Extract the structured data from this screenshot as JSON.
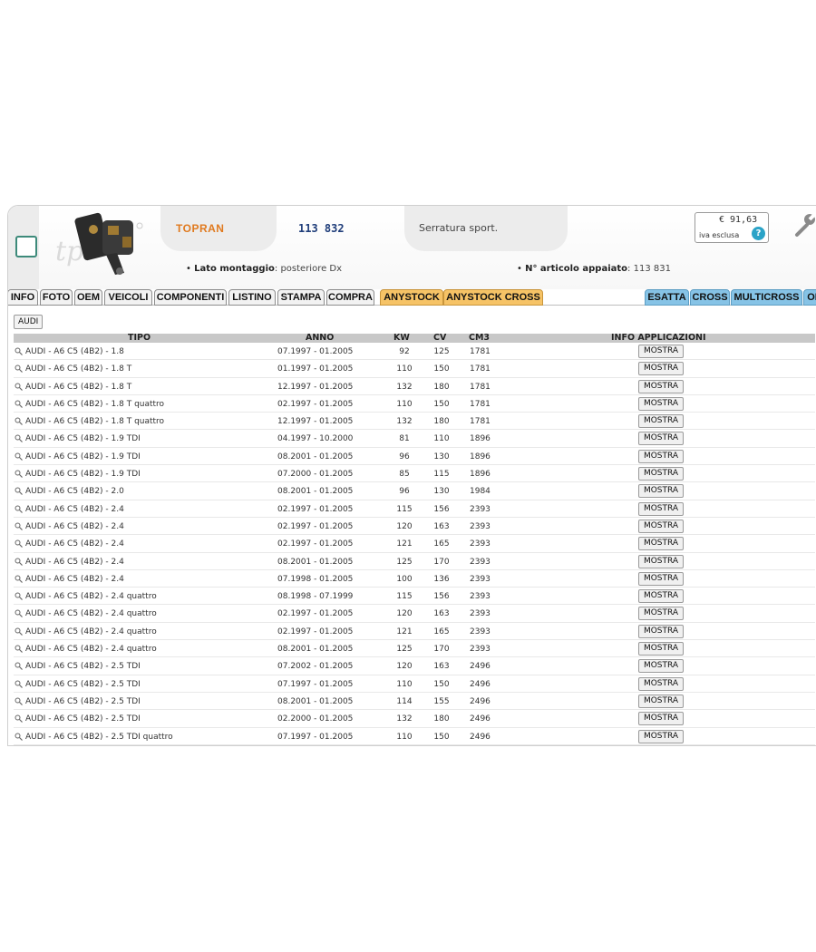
{
  "header": {
    "brand": "TOPRAN",
    "article_number": "113 832",
    "description": "Serratura sport.",
    "price": "€ 91,63",
    "price_note": "iva esclusa",
    "help_icon": "?",
    "mounting_label": "Lato montaggio",
    "mounting_value": ": posteriore Dx",
    "paired_label": "N° articolo appaiato",
    "paired_value": ": 113 831"
  },
  "tabs": [
    {
      "label": "INFO",
      "style": "grey"
    },
    {
      "label": "FOTO",
      "style": "grey"
    },
    {
      "label": "OEM",
      "style": "grey"
    },
    {
      "label": "VEICOLI",
      "style": "grey"
    },
    {
      "label": "COMPONENTI",
      "style": "grey"
    },
    {
      "label": "LISTINO",
      "style": "grey"
    },
    {
      "label": "STAMPA",
      "style": "grey"
    },
    {
      "label": "COMPRA",
      "style": "grey"
    },
    {
      "label": "ANYSTOCK",
      "style": "orange"
    },
    {
      "label": "ANYSTOCK CROSS",
      "style": "orange"
    },
    {
      "label": "ESATTA",
      "style": "blue"
    },
    {
      "label": "CROSS",
      "style": "blue"
    },
    {
      "label": "MULTICROSS",
      "style": "blue"
    },
    {
      "label": "OI",
      "style": "blue"
    }
  ],
  "filter": {
    "label": "AUDI"
  },
  "table": {
    "columns": {
      "tipo": "TIPO",
      "anno": "ANNO",
      "kw": "KW",
      "cv": "CV",
      "cm3": "CM3",
      "info": "INFO APPLICAZIONI"
    },
    "button_label": "MOSTRA",
    "rows": [
      {
        "tipo": "AUDI - A6 C5 (4B2) - 1.8",
        "anno": "07.1997 - 01.2005",
        "kw": "92",
        "cv": "125",
        "cm3": "1781"
      },
      {
        "tipo": "AUDI - A6 C5 (4B2) - 1.8 T",
        "anno": "01.1997 - 01.2005",
        "kw": "110",
        "cv": "150",
        "cm3": "1781"
      },
      {
        "tipo": "AUDI - A6 C5 (4B2) - 1.8 T",
        "anno": "12.1997 - 01.2005",
        "kw": "132",
        "cv": "180",
        "cm3": "1781"
      },
      {
        "tipo": "AUDI - A6 C5 (4B2) - 1.8 T quattro",
        "anno": "02.1997 - 01.2005",
        "kw": "110",
        "cv": "150",
        "cm3": "1781"
      },
      {
        "tipo": "AUDI - A6 C5 (4B2) - 1.8 T quattro",
        "anno": "12.1997 - 01.2005",
        "kw": "132",
        "cv": "180",
        "cm3": "1781"
      },
      {
        "tipo": "AUDI - A6 C5 (4B2) - 1.9 TDI",
        "anno": "04.1997 - 10.2000",
        "kw": "81",
        "cv": "110",
        "cm3": "1896"
      },
      {
        "tipo": "AUDI - A6 C5 (4B2) - 1.9 TDI",
        "anno": "08.2001 - 01.2005",
        "kw": "96",
        "cv": "130",
        "cm3": "1896"
      },
      {
        "tipo": "AUDI - A6 C5 (4B2) - 1.9 TDI",
        "anno": "07.2000 - 01.2005",
        "kw": "85",
        "cv": "115",
        "cm3": "1896"
      },
      {
        "tipo": "AUDI - A6 C5 (4B2) - 2.0",
        "anno": "08.2001 - 01.2005",
        "kw": "96",
        "cv": "130",
        "cm3": "1984"
      },
      {
        "tipo": "AUDI - A6 C5 (4B2) - 2.4",
        "anno": "02.1997 - 01.2005",
        "kw": "115",
        "cv": "156",
        "cm3": "2393"
      },
      {
        "tipo": "AUDI - A6 C5 (4B2) - 2.4",
        "anno": "02.1997 - 01.2005",
        "kw": "120",
        "cv": "163",
        "cm3": "2393"
      },
      {
        "tipo": "AUDI - A6 C5 (4B2) - 2.4",
        "anno": "02.1997 - 01.2005",
        "kw": "121",
        "cv": "165",
        "cm3": "2393"
      },
      {
        "tipo": "AUDI - A6 C5 (4B2) - 2.4",
        "anno": "08.2001 - 01.2005",
        "kw": "125",
        "cv": "170",
        "cm3": "2393"
      },
      {
        "tipo": "AUDI - A6 C5 (4B2) - 2.4",
        "anno": "07.1998 - 01.2005",
        "kw": "100",
        "cv": "136",
        "cm3": "2393"
      },
      {
        "tipo": "AUDI - A6 C5 (4B2) - 2.4 quattro",
        "anno": "08.1998 - 07.1999",
        "kw": "115",
        "cv": "156",
        "cm3": "2393"
      },
      {
        "tipo": "AUDI - A6 C5 (4B2) - 2.4 quattro",
        "anno": "02.1997 - 01.2005",
        "kw": "120",
        "cv": "163",
        "cm3": "2393"
      },
      {
        "tipo": "AUDI - A6 C5 (4B2) - 2.4 quattro",
        "anno": "02.1997 - 01.2005",
        "kw": "121",
        "cv": "165",
        "cm3": "2393"
      },
      {
        "tipo": "AUDI - A6 C5 (4B2) - 2.4 quattro",
        "anno": "08.2001 - 01.2005",
        "kw": "125",
        "cv": "170",
        "cm3": "2393"
      },
      {
        "tipo": "AUDI - A6 C5 (4B2) - 2.5 TDI",
        "anno": "07.2002 - 01.2005",
        "kw": "120",
        "cv": "163",
        "cm3": "2496"
      },
      {
        "tipo": "AUDI - A6 C5 (4B2) - 2.5 TDI",
        "anno": "07.1997 - 01.2005",
        "kw": "110",
        "cv": "150",
        "cm3": "2496"
      },
      {
        "tipo": "AUDI - A6 C5 (4B2) - 2.5 TDI",
        "anno": "08.2001 - 01.2005",
        "kw": "114",
        "cv": "155",
        "cm3": "2496"
      },
      {
        "tipo": "AUDI - A6 C5 (4B2) - 2.5 TDI",
        "anno": "02.2000 - 01.2005",
        "kw": "132",
        "cv": "180",
        "cm3": "2496"
      },
      {
        "tipo": "AUDI - A6 C5 (4B2) - 2.5 TDI quattro",
        "anno": "07.1997 - 01.2005",
        "kw": "110",
        "cv": "150",
        "cm3": "2496"
      }
    ]
  },
  "colors": {
    "brand": "#e07a1f",
    "article": "#1f3d7a",
    "tab_orange": "#f6c366",
    "tab_blue": "#86c3e6",
    "checkbox": "#3d8a7a"
  }
}
